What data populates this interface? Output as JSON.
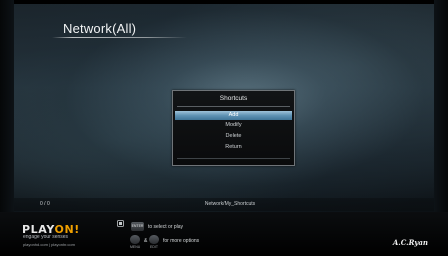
{
  "header": {
    "title": "Network(All)"
  },
  "dialog": {
    "title": "Shortcuts",
    "items": [
      {
        "label": "Add",
        "selected": true
      },
      {
        "label": "Modify",
        "selected": false
      },
      {
        "label": "Delete",
        "selected": false
      },
      {
        "label": "Return",
        "selected": false
      }
    ]
  },
  "status": {
    "page_count": "0 / 0",
    "path": "Network/My_Shortcuts"
  },
  "footer": {
    "logo_text": "PLAYON!",
    "tagline": "engage your senses",
    "sites": "playonhd.com | playonhr.com",
    "hint_enter_key": "ENTER",
    "hint_select": "to select or play",
    "hint_menu_key": "MENU",
    "hint_edit_key": "EDIT",
    "hint_and": "&",
    "hint_more": "for more options",
    "brand": "A.C.Ryan"
  },
  "colors": {
    "selection": "#5f93b4",
    "logo_accent": "#f0a000"
  },
  "icons": {
    "remote": "remote-icon"
  }
}
